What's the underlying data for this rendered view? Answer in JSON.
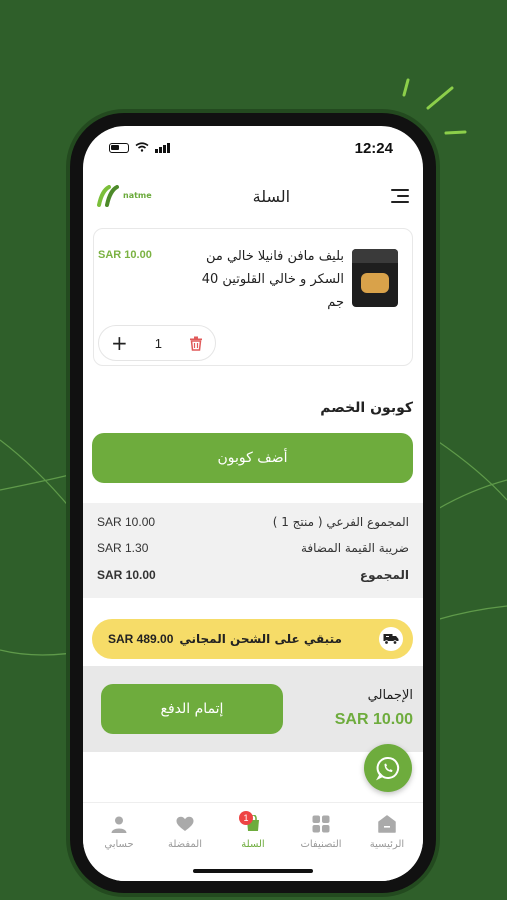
{
  "status_bar": {
    "time": "12:24"
  },
  "header": {
    "title": "السلة",
    "logo_text": "natme"
  },
  "cart": {
    "items": [
      {
        "name": "بليف مافن فانيلا خالي من السكر و خالي القلوتين 40 جم",
        "price": "SAR 10.00",
        "quantity": "1"
      }
    ]
  },
  "coupon": {
    "label": "كوبون الخصم",
    "button": "أضف كوبون"
  },
  "summary": {
    "subtotal_label": "المجموع الفرعي ( منتج 1 )",
    "subtotal_value": "SAR 10.00",
    "vat_label": "ضريبة القيمة المضافة",
    "vat_value": "SAR 1.30",
    "total_label": "المجموع",
    "total_value": "SAR 10.00"
  },
  "shipping": {
    "text": "متبقي على الشحن المجاني",
    "amount": "SAR 489.00"
  },
  "checkout": {
    "grand_label": "الإجمالي",
    "grand_value": "SAR 10.00",
    "button": "إتمام الدفع"
  },
  "tabs": [
    {
      "label": "الرئيسية",
      "icon": "home-icon"
    },
    {
      "label": "التصنيفات",
      "icon": "categories-icon"
    },
    {
      "label": "السلة",
      "icon": "cart-icon",
      "badge": "1",
      "active": true
    },
    {
      "label": "المفضلة",
      "icon": "heart-icon"
    },
    {
      "label": "حسابي",
      "icon": "user-icon"
    }
  ],
  "colors": {
    "brand_green": "#6eac3d",
    "background": "#2f5f2a",
    "shipping_banner": "#f6dc68",
    "badge": "#e44444"
  }
}
